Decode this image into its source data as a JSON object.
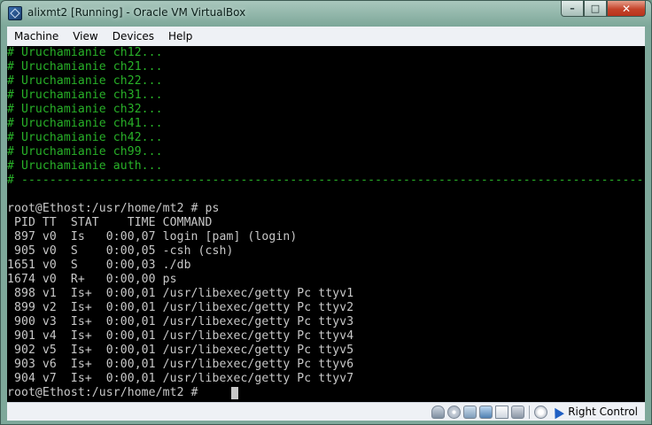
{
  "window": {
    "title": "alixmt2 [Running] - Oracle VM VirtualBox",
    "min_label": "–",
    "max_label": "□",
    "close_label": "✕"
  },
  "menu": [
    "Machine",
    "View",
    "Devices",
    "Help"
  ],
  "console": {
    "lines": [
      {
        "text": "# Uruchamianie ch12...",
        "color": "green"
      },
      {
        "text": "# Uruchamianie ch21...",
        "color": "green"
      },
      {
        "text": "# Uruchamianie ch22...",
        "color": "green"
      },
      {
        "text": "# Uruchamianie ch31...",
        "color": "green"
      },
      {
        "text": "# Uruchamianie ch32...",
        "color": "green"
      },
      {
        "text": "# Uruchamianie ch41...",
        "color": "green"
      },
      {
        "text": "# Uruchamianie ch42...",
        "color": "green"
      },
      {
        "text": "# Uruchamianie ch99...",
        "color": "green"
      },
      {
        "text": "# Uruchamianie auth...",
        "color": "green"
      },
      {
        "text": "# ------------------------------------------------------------------------------------------ #",
        "color": "green"
      },
      {
        "text": "",
        "color": "white"
      },
      {
        "text": "root@Ethost:/usr/home/mt2 # ps",
        "color": "white"
      },
      {
        "text": " PID TT  STAT    TIME COMMAND",
        "color": "white"
      },
      {
        "text": " 897 v0  Is   0:00,07 login [pam] (login)",
        "color": "white"
      },
      {
        "text": " 905 v0  S    0:00,05 -csh (csh)",
        "color": "white"
      },
      {
        "text": "1651 v0  S    0:00,03 ./db",
        "color": "white"
      },
      {
        "text": "1674 v0  R+   0:00,00 ps",
        "color": "white"
      },
      {
        "text": " 898 v1  Is+  0:00,01 /usr/libexec/getty Pc ttyv1",
        "color": "white"
      },
      {
        "text": " 899 v2  Is+  0:00,01 /usr/libexec/getty Pc ttyv2",
        "color": "white"
      },
      {
        "text": " 900 v3  Is+  0:00,01 /usr/libexec/getty Pc ttyv3",
        "color": "white"
      },
      {
        "text": " 901 v4  Is+  0:00,01 /usr/libexec/getty Pc ttyv4",
        "color": "white"
      },
      {
        "text": " 902 v5  Is+  0:00,01 /usr/libexec/getty Pc ttyv5",
        "color": "white"
      },
      {
        "text": " 903 v6  Is+  0:00,01 /usr/libexec/getty Pc ttyv6",
        "color": "white"
      },
      {
        "text": " 904 v7  Is+  0:00,01 /usr/libexec/getty Pc ttyv7",
        "color": "white"
      },
      {
        "text": "root@Ethost:/usr/home/mt2 # ",
        "color": "white"
      }
    ]
  },
  "statusbar": {
    "host_key": "Right Control",
    "icons": [
      "hard-disk-icon",
      "optical-drive-icon",
      "usb-icon",
      "network-icon",
      "shared-folders-icon",
      "display-icon",
      "mouse-integration-icon",
      "capture-arrow-icon"
    ]
  },
  "colors": {
    "console_bg": "#000000",
    "console_text": "#c8c8c8",
    "console_green": "#28b128"
  }
}
